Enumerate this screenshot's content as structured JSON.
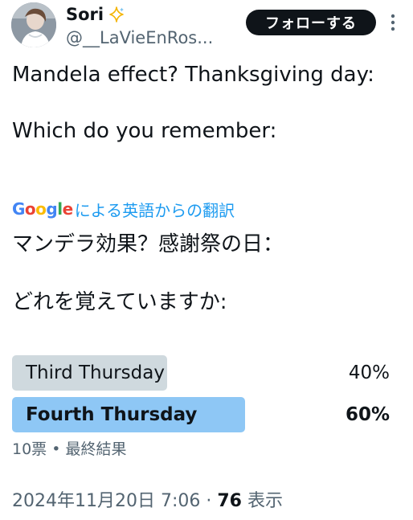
{
  "author": {
    "display_name": "Sori",
    "badge_icon": "sparkle-icon",
    "handle": "@__LaVieEnRos..."
  },
  "follow_button": {
    "label": "フォローする"
  },
  "more_icon": "more-vertical-icon",
  "tweet": {
    "text": "Mandela effect? Thanksgiving day:\n\nWhich do you remember:"
  },
  "translation": {
    "provider": "Google",
    "label": "による英語からの翻訳",
    "text": "マンデラ効果？感謝祭の日：\n\nどれを覚えていますか:"
  },
  "poll": {
    "options": [
      {
        "label": "Third Thursday",
        "percent_text": "40%",
        "percent": 40,
        "winner": false
      },
      {
        "label": "Fourth Thursday",
        "percent_text": "60%",
        "percent": 60,
        "winner": true
      }
    ],
    "meta": "10票 • 最終結果"
  },
  "footer": {
    "timestamp": "2024年11月20日 7:06",
    "separator": " · ",
    "views_count": "76",
    "views_label": " 表示"
  },
  "colors": {
    "follow_bg": "#0f1419",
    "poll_winner": "#8ec7f5",
    "poll_loser": "#cfd9de",
    "link_blue": "#1d9bf0",
    "secondary_text": "#536471"
  }
}
